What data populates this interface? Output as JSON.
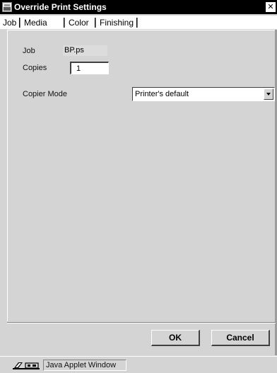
{
  "window": {
    "title": "Override Print Settings",
    "close_glyph": "✕"
  },
  "tabs": [
    {
      "label": "Job",
      "selected": true
    },
    {
      "label": "Media",
      "selected": false
    },
    {
      "label": "Color",
      "selected": false
    },
    {
      "label": "Finishing",
      "selected": false
    }
  ],
  "job": {
    "job_label": "Job",
    "job_value": "BP.ps",
    "copies_label": "Copies",
    "copies_value": "1",
    "copier_mode_label": "Copier Mode",
    "copier_mode_value": "Printer's default"
  },
  "buttons": {
    "ok_label": "OK",
    "cancel_label": "Cancel"
  },
  "statusbar": {
    "text": "Java Applet Window",
    "icon": "java-applet-warning-icon"
  },
  "colors": {
    "titlebar_bg": "#000000",
    "panel_bg": "#d4d4d4"
  }
}
